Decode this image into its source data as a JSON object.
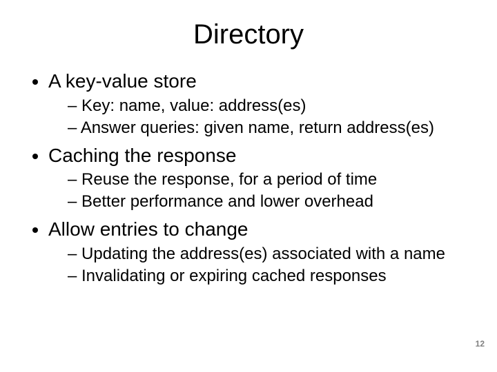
{
  "title": "Directory",
  "bullets": [
    {
      "text": "A key-value store",
      "sub": [
        "Key: name, value: address(es)",
        "Answer queries: given name, return address(es)"
      ]
    },
    {
      "text": "Caching the response",
      "sub": [
        "Reuse the response, for a period of time",
        "Better performance and lower overhead"
      ]
    },
    {
      "text": "Allow entries to change",
      "sub": [
        "Updating the address(es) associated with a name",
        "Invalidating or expiring cached responses"
      ]
    }
  ],
  "page_number": "12"
}
